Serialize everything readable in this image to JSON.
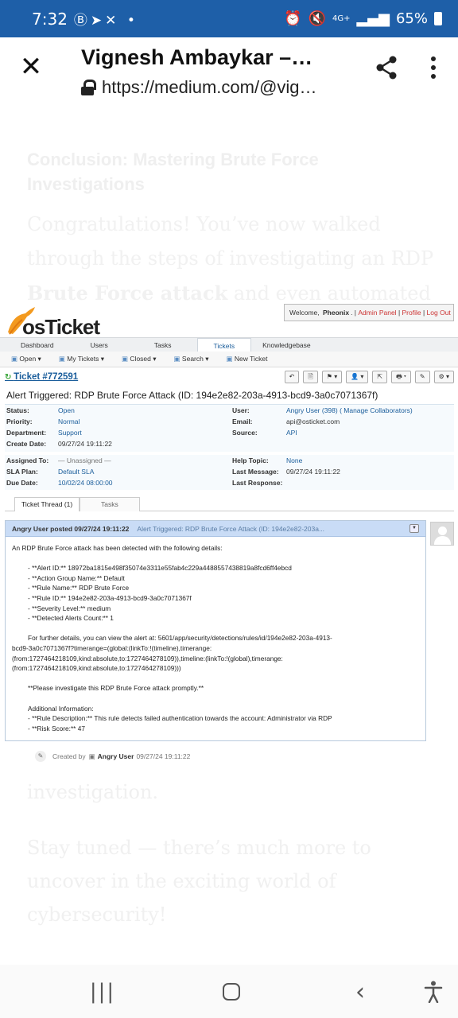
{
  "status_bar": {
    "time": "7:32",
    "left_icons": [
      "b-icon",
      "telegram-icon",
      "missed-call-icon",
      "dot"
    ],
    "network": "4G+",
    "battery": "65%"
  },
  "browser": {
    "title": "Vignesh Ambaykar –…",
    "url": "https://medium.com/@vig…"
  },
  "article": {
    "heading": "Conclusion: Mastering Brute Force Investigations",
    "para1_a": "Congratulations! You’ve now walked through the steps of investigating an RDP ",
    "para1_b": "Brute Force attack",
    "para1_c": " and even automated",
    "para2": "investigation.",
    "para3": "Stay tuned — there’s much more to uncover in the exciting world of cybersecurity!"
  },
  "osticket": {
    "logo": "osTicket",
    "welcome_prefix": "Welcome,",
    "user": "Pheonix",
    "links": [
      "Admin Panel",
      "Profile",
      "Log Out"
    ],
    "nav_tabs": [
      "Dashboard",
      "Users",
      "Tasks",
      "Tickets",
      "Knowledgebase"
    ],
    "active_tab": "Tickets",
    "subnav": [
      "Open ▾",
      "My Tickets ▾",
      "Closed ▾",
      "Search ▾",
      "New Ticket"
    ],
    "ticket_number": "Ticket #772591",
    "toolbar": [
      "↶",
      "🖹",
      "⚑ ▾",
      "👤 ▾",
      "⇱",
      "🖶 ▾",
      "✎",
      "⚙ ▾"
    ],
    "subject": "Alert Triggered: RDP Brute Force Attack (ID: 194e2e82-203a-4913-bcd9-3a0c7071367f)",
    "info_left": [
      {
        "k": "Status:",
        "v": "Open"
      },
      {
        "k": "Priority:",
        "v": "Normal"
      },
      {
        "k": "Department:",
        "v": "Support"
      },
      {
        "k": "Create Date:",
        "v": "09/27/24 19:11:22"
      }
    ],
    "info_right": [
      {
        "k": "User:",
        "v": "Angry User (398) ( Manage Collaborators)"
      },
      {
        "k": "Email:",
        "v": "api@osticket.com"
      },
      {
        "k": "Source:",
        "v": "API"
      }
    ],
    "info2_left": [
      {
        "k": "Assigned To:",
        "v": "— Unassigned —"
      },
      {
        "k": "SLA Plan:",
        "v": "Default SLA"
      },
      {
        "k": "Due Date:",
        "v": "10/02/24 08:00:00"
      }
    ],
    "info2_right": [
      {
        "k": "Help Topic:",
        "v": "None"
      },
      {
        "k": "Last Message:",
        "v": "09/27/24 19:11:22"
      },
      {
        "k": "Last Response:",
        "v": ""
      }
    ],
    "thread_tabs": [
      "Ticket Thread (1)",
      "Tasks"
    ],
    "post": {
      "author_line": "Angry User posted 09/27/24 19:11:22",
      "subject_preview": "Alert Triggered: RDP Brute Force Attack (ID: 194e2e82-203a...",
      "intro": "An RDP Brute Force attack has been detected with the following details:",
      "items": [
        "- **Alert ID:** 18972ba1815e498f35074e3311e55fab4c229a4488557438819a8fcd6ff4ebcd",
        "- **Action Group Name:** Default",
        "- **Rule Name:** RDP Brute Force",
        "- **Rule ID:** 194e2e82-203a-4913-bcd9-3a0c7071367f",
        "- **Severity Level:** medium",
        "- **Detected Alerts Count:** 1"
      ],
      "details_1": "For further details, you can view the alert at:                                  5601/app/security/detections/rules/id/194e2e82-203a-4913-",
      "details_2": "bcd9-3a0c7071367f?timerange=(global:(linkTo:!(timeline),timerange:",
      "details_3": "(from:1727464218109,kind:absolute,to:1727464278109)),timeline:(linkTo:!(global),timerange:",
      "details_4": "(from:1727464218109,kind:absolute,to:1727464278109)))",
      "please": "**Please investigate this RDP Brute Force attack promptly.**",
      "additional": "Additional Information:",
      "extra": [
        "- **Rule Description:** This rule detects failed authentication towards the account: Administrator via RDP",
        "- **Risk Score:** 47"
      ]
    },
    "created_by": "Created by",
    "created_user": "Angry User",
    "created_date": "09/27/24 19:11:22"
  }
}
